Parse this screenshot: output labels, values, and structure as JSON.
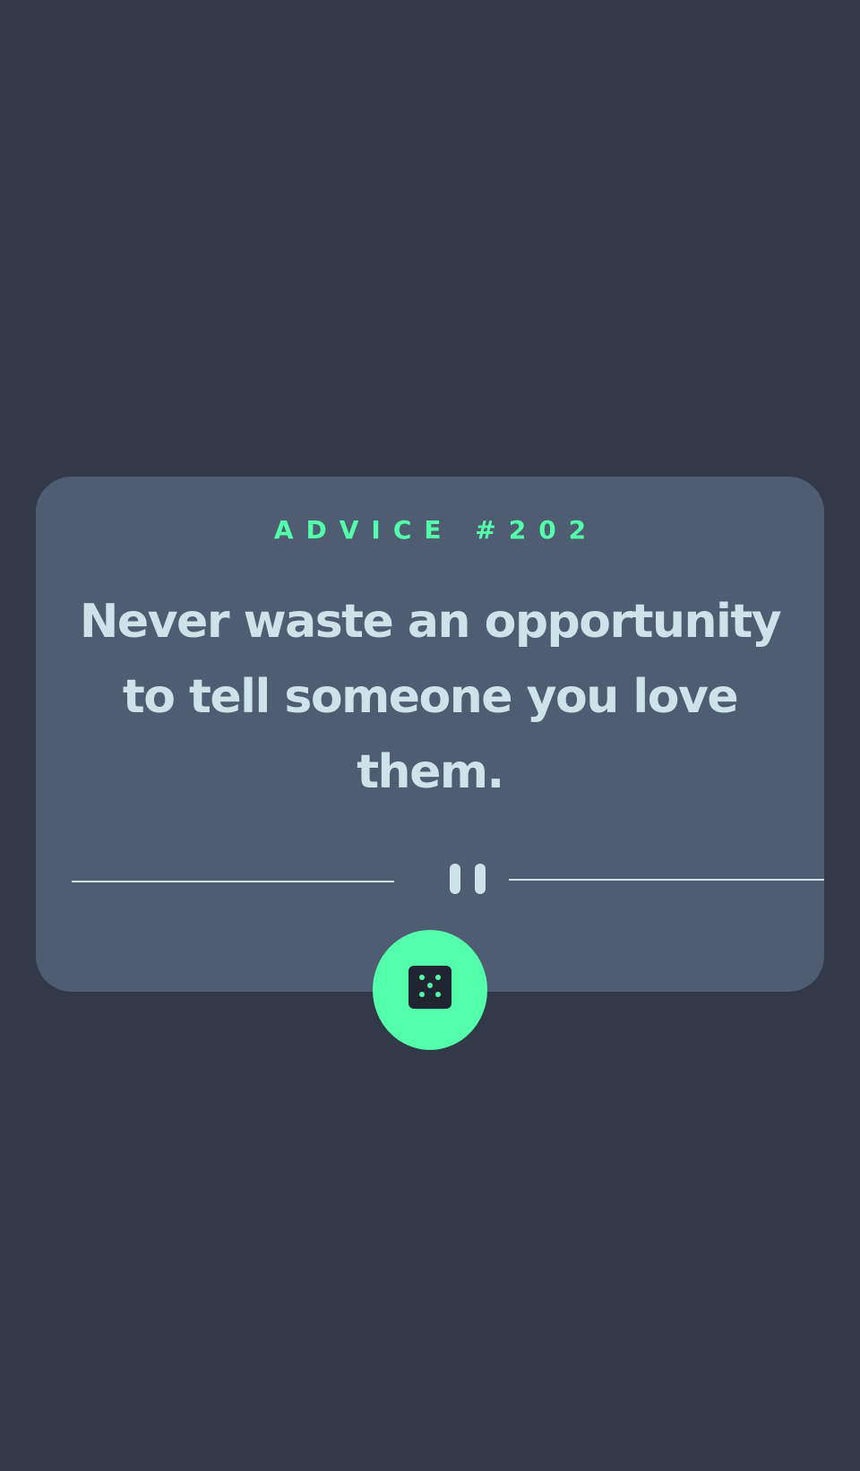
{
  "advice": {
    "id_label": "ADVICE #202",
    "text": "Never waste an opportunity to tell someone you love them."
  },
  "icons": {
    "divider": "pause-icon",
    "button": "dice-icon"
  },
  "colors": {
    "background": "#323a49",
    "card": "#4f5d73",
    "accent": "#53ffaa",
    "text": "#cee3e9",
    "dice_face": "#1f2632"
  }
}
